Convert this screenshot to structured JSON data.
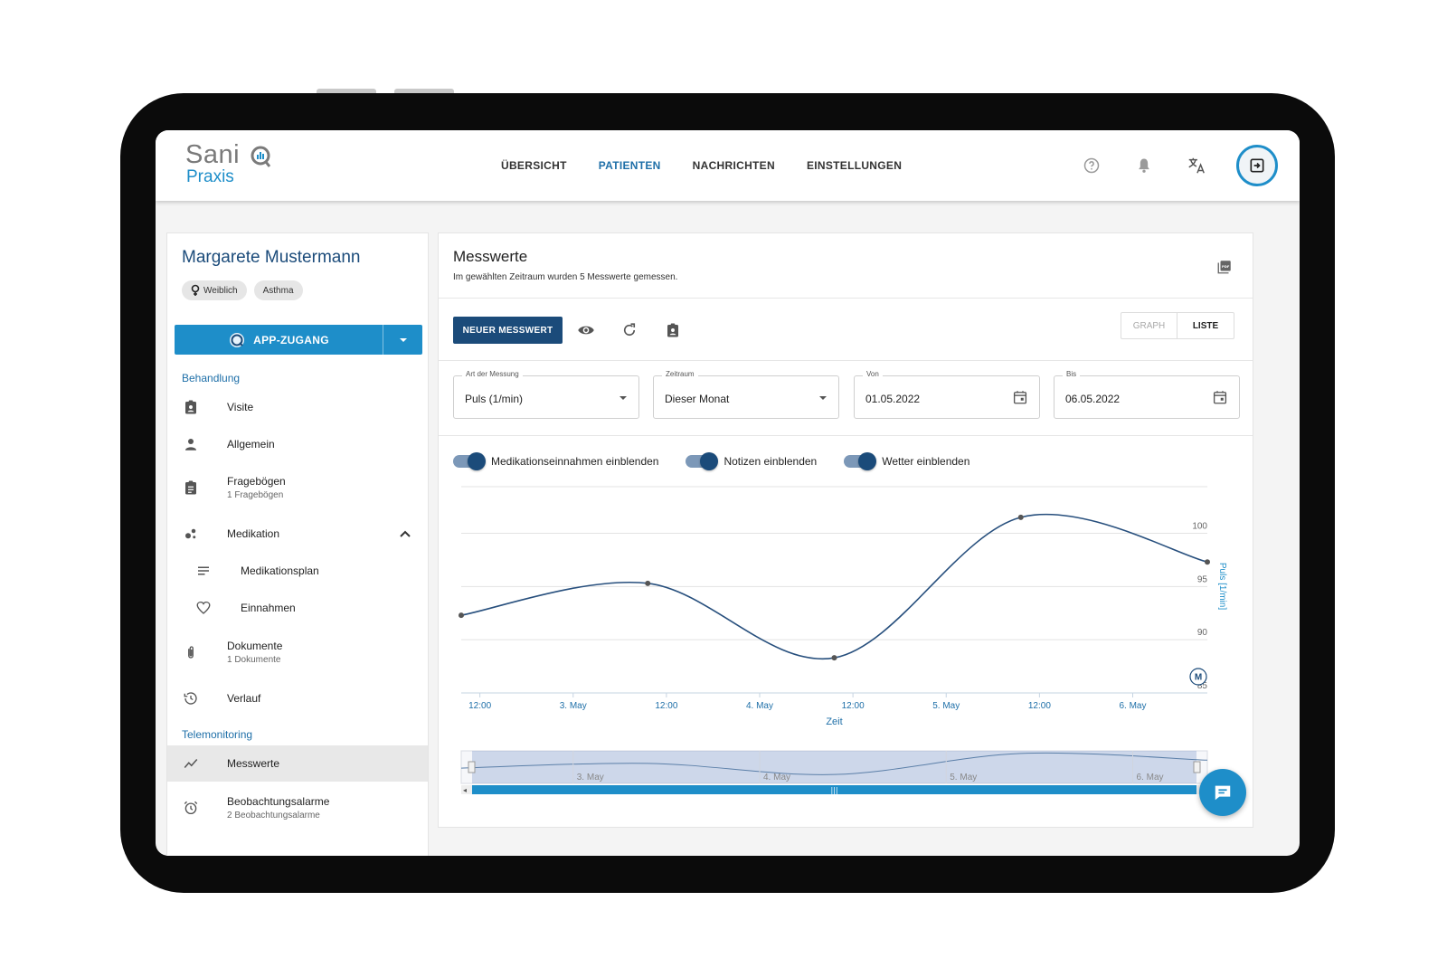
{
  "app": {
    "logo_text_top": "Sani",
    "logo_text_bottom": "Praxis"
  },
  "nav": {
    "items": [
      {
        "label": "ÜBERSICHT"
      },
      {
        "label": "PATIENTEN"
      },
      {
        "label": "NACHRICHTEN"
      },
      {
        "label": "EINSTELLUNGEN"
      }
    ],
    "active": "PATIENTEN"
  },
  "header_icons": [
    "help-icon",
    "bell-icon",
    "translate-icon",
    "logout-icon"
  ],
  "patient": {
    "name": "Margarete Mustermann",
    "chips": [
      "Weiblich",
      "Asthma"
    ],
    "app_access_label": "APP-ZUGANG"
  },
  "sidebar": {
    "section_treatment": "Behandlung",
    "section_telemonitoring": "Telemonitoring",
    "items": [
      {
        "label": "Visite",
        "icon": "clipboard-account-icon"
      },
      {
        "label": "Allgemein",
        "icon": "person-icon"
      },
      {
        "label": "Fragebögen",
        "sublabel": "1 Fragebögen",
        "icon": "clipboard-list-icon"
      },
      {
        "label": "Medikation",
        "icon": "medication-icon"
      },
      {
        "label": "Medikationsplan",
        "icon": "list-icon"
      },
      {
        "label": "Einnahmen",
        "icon": "heart-icon"
      },
      {
        "label": "Dokumente",
        "sublabel": "1 Dokumente",
        "icon": "paperclip-icon"
      },
      {
        "label": "Verlauf",
        "icon": "history-icon"
      },
      {
        "label": "Messwerte",
        "icon": "chart-line-icon"
      },
      {
        "label": "Beobachtungsalarme",
        "sublabel": "2 Beobachtungsalarme",
        "icon": "alarm-icon"
      }
    ]
  },
  "main": {
    "title": "Messwerte",
    "subtitle": "Im gewählten Zeitraum wurden 5 Messwerte gemessen.",
    "new_button": "NEUER MESSWERT",
    "view_graph": "GRAPH",
    "view_list": "LISTE",
    "fields": {
      "type": {
        "label": "Art der Messung",
        "value": "Puls (1/min)"
      },
      "period": {
        "label": "Zeitraum",
        "value": "Dieser Monat"
      },
      "from": {
        "label": "Von",
        "value": "01.05.2022"
      },
      "to": {
        "label": "Bis",
        "value": "06.05.2022"
      }
    },
    "switches": [
      {
        "label": "Medikationseinnahmen einblenden",
        "on": true
      },
      {
        "label": "Notizen einblenden",
        "on": true
      },
      {
        "label": "Wetter einblenden",
        "on": true
      }
    ],
    "marker_label": "M"
  },
  "colors": {
    "primary": "#1b4b7a",
    "accent": "#1e8ec9",
    "line": "#274f7d"
  },
  "chart_data": {
    "type": "line",
    "xlabel": "Zeit",
    "ylabel": "Puls [1/min]",
    "x_tick_labels": [
      "12:00",
      "3. May",
      "12:00",
      "4. May",
      "12:00",
      "5. May",
      "12:00",
      "6. May"
    ],
    "x_ticks_hours": [
      12,
      24,
      36,
      48,
      60,
      72,
      84,
      96
    ],
    "y_ticks": [
      85,
      90,
      95,
      100
    ],
    "ylim": [
      85,
      102
    ],
    "xlim_hours": [
      9.6,
      105.6
    ],
    "series": [
      {
        "points": [
          {
            "t_hours": 9.6,
            "value": 92.3
          },
          {
            "t_hours": 33.6,
            "value": 95.3
          },
          {
            "t_hours": 57.6,
            "value": 88.3
          },
          {
            "t_hours": 81.6,
            "value": 101.5
          },
          {
            "t_hours": 105.6,
            "value": 97.3
          }
        ]
      }
    ],
    "navigator_labels": [
      "3. May",
      "4. May",
      "5. May",
      "6. May"
    ],
    "grid": true
  }
}
